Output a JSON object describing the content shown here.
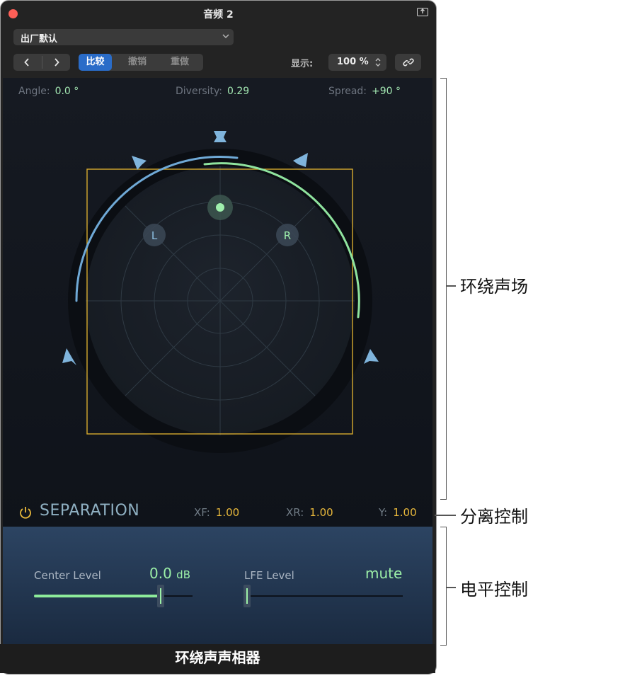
{
  "window": {
    "title": "音频 2",
    "preset": "出厂默认",
    "compare_label": "比较",
    "undo_label": "撤销",
    "redo_label": "重做",
    "display_label": "显示:",
    "zoom_value": "100 %"
  },
  "surround": {
    "angle_label": "Angle:",
    "angle_value": "0.0 °",
    "diversity_label": "Diversity:",
    "diversity_value": "0.29",
    "spread_label": "Spread:",
    "spread_value": "+90 °",
    "left_channel": "L",
    "right_channel": "R"
  },
  "separation": {
    "title": "SEPARATION",
    "xf_label": "XF:",
    "xf_value": "1.00",
    "xr_label": "XR:",
    "xr_value": "1.00",
    "y_label": "Y:",
    "y_value": "1.00"
  },
  "levels": {
    "center_label": "Center Level",
    "center_value": "0.0",
    "center_unit": "dB",
    "center_fraction": 0.8,
    "lfe_label": "LFE Level",
    "lfe_value": "mute",
    "lfe_fraction": 0.0
  },
  "footer": {
    "caption": "环绕声声相器"
  },
  "callouts": {
    "surround_field": "环绕声场",
    "separation_controls": "分离控制",
    "level_controls": "电平控制"
  },
  "colors": {
    "accent_blue": "#2a6cc8",
    "arc_blue": "#6fa9d6",
    "arc_green": "#8fe39e",
    "box_yellow": "#e8b83b",
    "close_red": "#fe5f57"
  }
}
